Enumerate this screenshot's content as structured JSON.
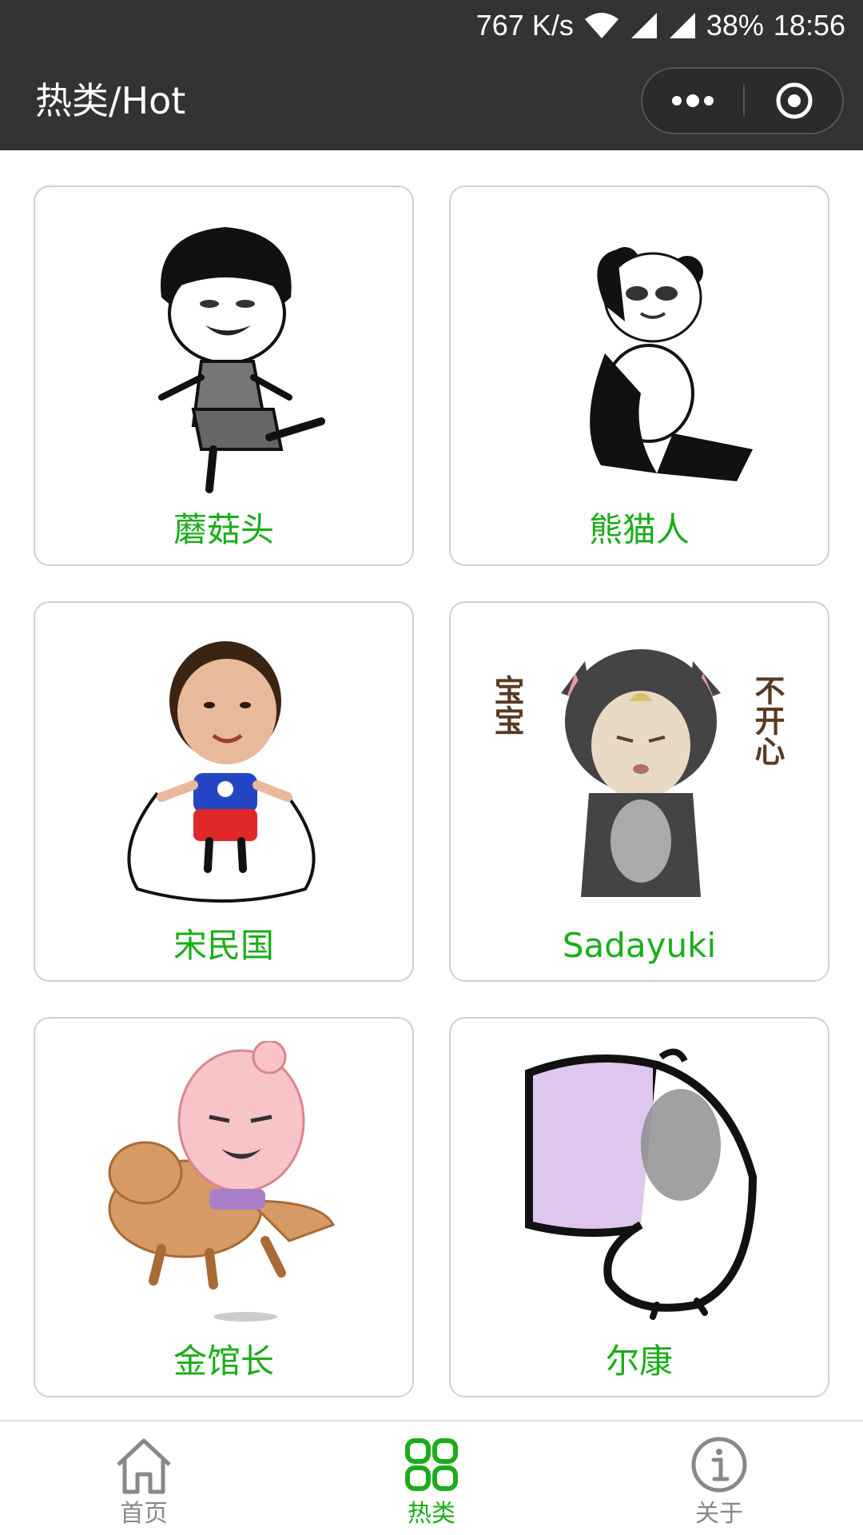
{
  "status_bar": {
    "network_speed": "767 K/s",
    "battery": "38%",
    "time": "18:56"
  },
  "nav": {
    "title": "热类/Hot"
  },
  "cards": [
    {
      "label": "蘑菇头"
    },
    {
      "label": "熊猫人"
    },
    {
      "label": "宋民国"
    },
    {
      "label": "Sadayuki"
    },
    {
      "label": "金馆长"
    },
    {
      "label": "尔康"
    }
  ],
  "card_texts": {
    "sadayuki_left": "宝宝",
    "sadayuki_right": "不开心"
  },
  "tabbar": {
    "items": [
      {
        "label": "首页",
        "icon": "home-icon",
        "active": false
      },
      {
        "label": "热类",
        "icon": "grid-icon",
        "active": true
      },
      {
        "label": "关于",
        "icon": "info-icon",
        "active": false
      }
    ]
  },
  "colors": {
    "accent": "#1aad19",
    "header_bg": "#333333",
    "inactive": "#888888"
  }
}
